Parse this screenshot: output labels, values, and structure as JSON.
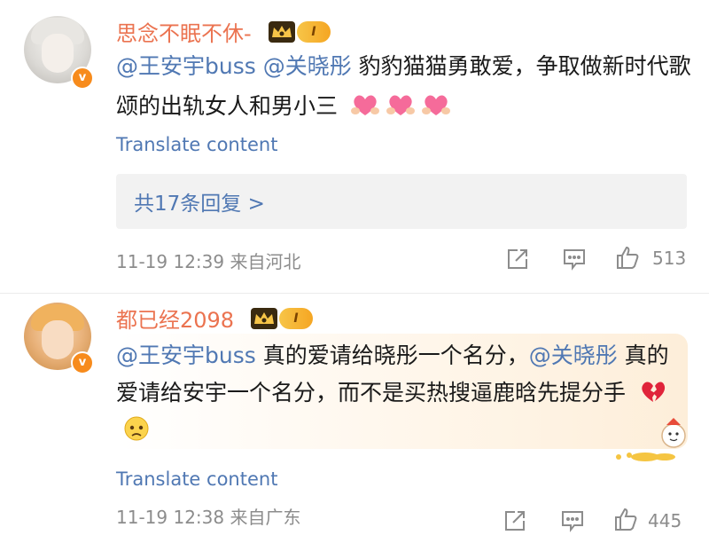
{
  "comments": [
    {
      "username": "思念不眠不休-",
      "level": "I",
      "verified": "v",
      "text": [
        {
          "type": "mention",
          "value": "@王安宇buss"
        },
        {
          "type": "text",
          "value": " "
        },
        {
          "type": "mention",
          "value": "@关晓彤"
        },
        {
          "type": "text",
          "value": " 豹豹猫猫勇敢爱，争取做新时代歌颂的出轨女人和男小三"
        }
      ],
      "emojis": [
        "heart-hands-emoji",
        "heart-hands-emoji",
        "heart-hands-emoji"
      ],
      "translate_label": "Translate content",
      "replies_label": "共17条回复 >",
      "time": "11-19 12:39",
      "location": "来自河北",
      "likes": "513"
    },
    {
      "username": "都已经2098",
      "level": "I",
      "verified": "v",
      "text": [
        {
          "type": "mention",
          "value": "@王安宇buss"
        },
        {
          "type": "text",
          "value": " 真的爱请给晓彤一个名分，"
        },
        {
          "type": "mention",
          "value": "@关晓彤"
        },
        {
          "type": "text",
          "value": " 真的爱请给安宇一个名分，而不是买热搜逼鹿晗先提分手"
        }
      ],
      "emojis": [
        "broken-heart-emoji",
        "sad-face-emoji"
      ],
      "translate_label": "Translate content",
      "time": "11-19 12:38",
      "location": "来自广东",
      "likes": "445"
    }
  ],
  "colors": {
    "username": "#eb7350",
    "mention": "#5078b3",
    "meta": "#8c8c8c",
    "verified_badge": "#f78b1c",
    "replies_bg": "#f2f2f2"
  }
}
